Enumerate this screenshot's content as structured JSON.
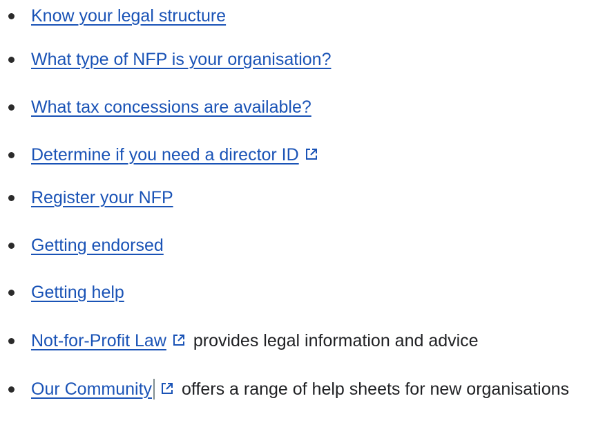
{
  "links": [
    {
      "label": "Know your legal structure"
    },
    {
      "label": "What type of NFP is your organisation?"
    },
    {
      "label": "What tax concessions are available?"
    },
    {
      "label": "Determine if you need a director ID"
    },
    {
      "label": "Register your NFP"
    },
    {
      "label": "Getting endorsed"
    },
    {
      "label": "Getting help"
    },
    {
      "label": "Not-for-Profit Law",
      "desc": "provides legal information and advice"
    },
    {
      "label": "Our Community",
      "desc": "offers a range of help sheets for new organisations"
    }
  ],
  "icons": {
    "external": "external-link-icon"
  },
  "colors": {
    "link": "#1a53b6",
    "text": "#202124",
    "bullet": "#2b2b2b"
  }
}
